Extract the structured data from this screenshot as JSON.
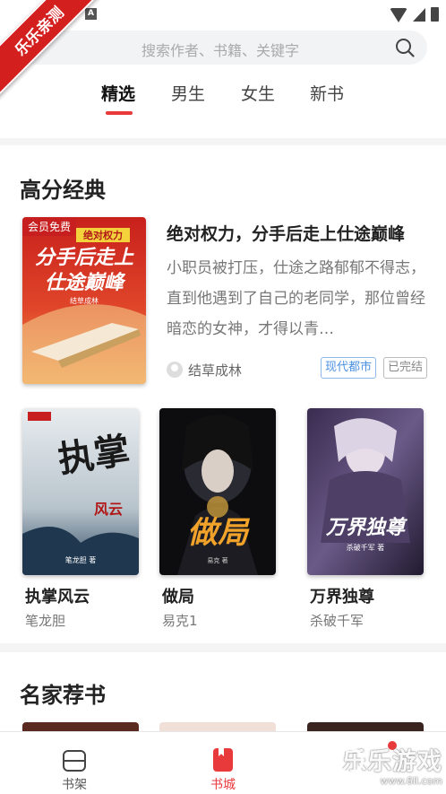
{
  "corner_ribbon": "乐乐亲测",
  "statusbar": {
    "notif_letter": "A"
  },
  "search": {
    "placeholder": "搜索作者、书籍、关键字"
  },
  "tabs": [
    {
      "label": "精选",
      "active": true
    },
    {
      "label": "男生",
      "active": false
    },
    {
      "label": "女生",
      "active": false
    },
    {
      "label": "新书",
      "active": false
    }
  ],
  "section_high": {
    "title": "高分经典",
    "featured": {
      "badge": "会员免费",
      "cover_title_line1": "分手后走上",
      "cover_title_line2": "仕途巅峰",
      "cover_top": "绝对权力",
      "cover_author": "结草成林",
      "title": "绝对权力，分手后走上仕途巅峰",
      "desc": "小职员被打压，仕途之路郁郁不得志，直到他遇到了自己的老同学，那位曾经暗恋的女神，才得以青…",
      "author": "结草成林",
      "tags": [
        "现代都市",
        "已完结"
      ]
    },
    "books": [
      {
        "title": "执掌风云",
        "author": "笔龙胆",
        "cover_text": "执掌",
        "cover_sub": "风云",
        "cover_author": "笔龙胆 著"
      },
      {
        "title": "做局",
        "author": "易克1",
        "cover_text": "做局",
        "cover_author": "易克 著"
      },
      {
        "title": "万界独尊",
        "author": "杀破千军",
        "cover_text": "万界独尊",
        "cover_author": "杀破千军 著"
      }
    ]
  },
  "section_famous": {
    "title": "名家荐书"
  },
  "bottom_nav": [
    {
      "label": "书架",
      "icon": "bookshelf-icon",
      "active": false
    },
    {
      "label": "书城",
      "icon": "bookstore-icon",
      "active": true
    }
  ],
  "watermark": {
    "big": "乐乐游戏",
    "small": "www.6ll.com"
  },
  "colors": {
    "accent": "#e8393b",
    "vip_badge": "#c71f1f",
    "tag_blue": "#4a90e2"
  }
}
